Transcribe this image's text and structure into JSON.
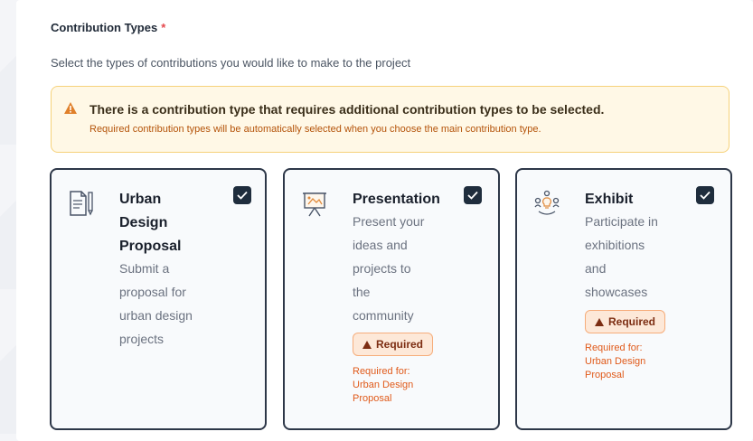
{
  "section": {
    "title": "Contribution Types",
    "required_mark": "*",
    "description": "Select the types of contributions you would like to make to the project"
  },
  "alert": {
    "title": "There is a contribution type that requires additional contribution types to be selected.",
    "text": "Required contribution types will be automatically selected when you choose the main contribution type."
  },
  "cards": [
    {
      "icon": "document-pen-icon",
      "title_lines": [
        "Urban",
        "Design",
        "Proposal"
      ],
      "desc_lines": [
        "Submit a",
        "proposal for",
        "urban design",
        "projects"
      ],
      "checked": true
    },
    {
      "icon": "presentation-board-icon",
      "title_lines": [
        "Presentation"
      ],
      "desc_lines": [
        "Present your",
        "ideas and",
        "projects to",
        "the",
        "community"
      ],
      "checked": true,
      "badge": "Required",
      "required_for_lines": [
        "Required for:",
        "Urban Design",
        "Proposal"
      ]
    },
    {
      "icon": "people-lightbulb-icon",
      "title_lines": [
        "Exhibit"
      ],
      "desc_lines": [
        "Participate in",
        "exhibitions",
        "and",
        "showcases"
      ],
      "checked": true,
      "badge": "Required",
      "required_for_lines": [
        "Required for:",
        "Urban Design",
        "Proposal"
      ]
    }
  ],
  "colors": {
    "accent_dark": "#1f2d3d",
    "warning_bg": "#fff8e6",
    "warning_text": "#b45309",
    "required_text": "#e05a1a"
  }
}
